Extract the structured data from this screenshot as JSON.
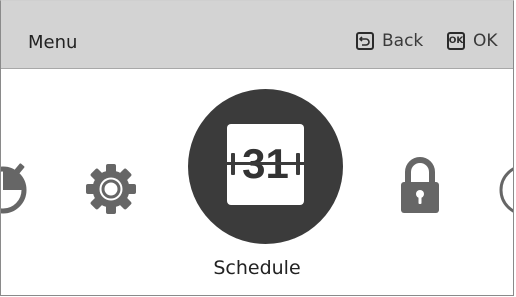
{
  "header": {
    "title": "Menu",
    "back_label": "Back",
    "ok_label": "OK",
    "ok_key_glyph": "OK",
    "back_icon": "back-arrow-icon",
    "ok_icon": "ok-key-icon"
  },
  "carousel": {
    "items": [
      {
        "icon": "timer-icon",
        "state": "partial-left"
      },
      {
        "icon": "gear-icon",
        "state": "normal"
      },
      {
        "icon": "calendar-icon",
        "state": "selected"
      },
      {
        "icon": "lock-icon",
        "state": "normal"
      },
      {
        "icon": "clock-icon",
        "state": "partial-right"
      }
    ],
    "selected_day": "31",
    "selected_label": "Schedule"
  },
  "colors": {
    "header_bg": "#d3d3d3",
    "icon_gray": "#666666",
    "selected_bg": "#3b3b3b",
    "text": "#222222"
  }
}
